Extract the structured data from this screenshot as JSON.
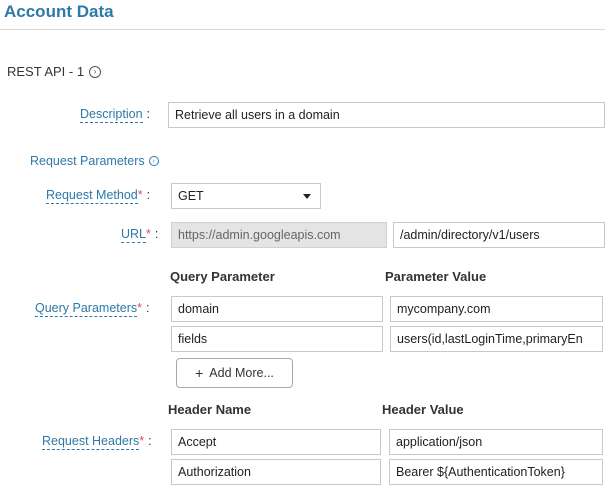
{
  "page": {
    "title": "Account Data"
  },
  "api": {
    "section_label": "REST API - 1",
    "description_label": "Description",
    "description_value": "Retrieve all users in a domain",
    "request_params_label": "Request Parameters",
    "method_label": "Request Method",
    "method_value": "GET",
    "url_label": "URL",
    "url_base": "https://admin.googleapis.com",
    "url_path": "/admin/directory/v1/users",
    "query": {
      "label": "Query Parameters",
      "col_param": "Query Parameter",
      "col_value": "Parameter Value",
      "rows": [
        {
          "param": "domain",
          "value": "mycompany.com"
        },
        {
          "param": "fields",
          "value": "users(id,lastLoginTime,primaryEn"
        }
      ],
      "add_more": "Add More..."
    },
    "headers": {
      "label": "Request Headers",
      "col_name": "Header Name",
      "col_value": "Header Value",
      "rows": [
        {
          "name": "Accept",
          "value": "application/json"
        },
        {
          "name": "Authorization",
          "value": "Bearer ${AuthenticationToken}"
        }
      ]
    },
    "required_mark": "*",
    "colon": ":"
  },
  "icons": {
    "section_expand": "chevron-circle-right-icon",
    "add": "plus-icon",
    "dropdown": "caret-down-icon"
  },
  "colors": {
    "accent": "#2d79a8",
    "required": "#d9534f"
  }
}
